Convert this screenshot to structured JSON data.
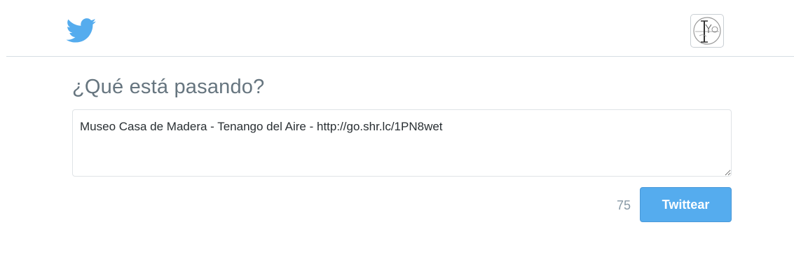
{
  "header": {
    "logo_icon": "twitter-bird-icon",
    "brand_color": "#55acee",
    "avatar_icon": "user-avatar-logo"
  },
  "compose": {
    "heading": "¿Qué está pasando?",
    "text": "Museo Casa de Madera - Tenango del Aire - http://go.shr.lc/1PN8wet",
    "char_count": "75",
    "submit_label": "Twittear"
  }
}
